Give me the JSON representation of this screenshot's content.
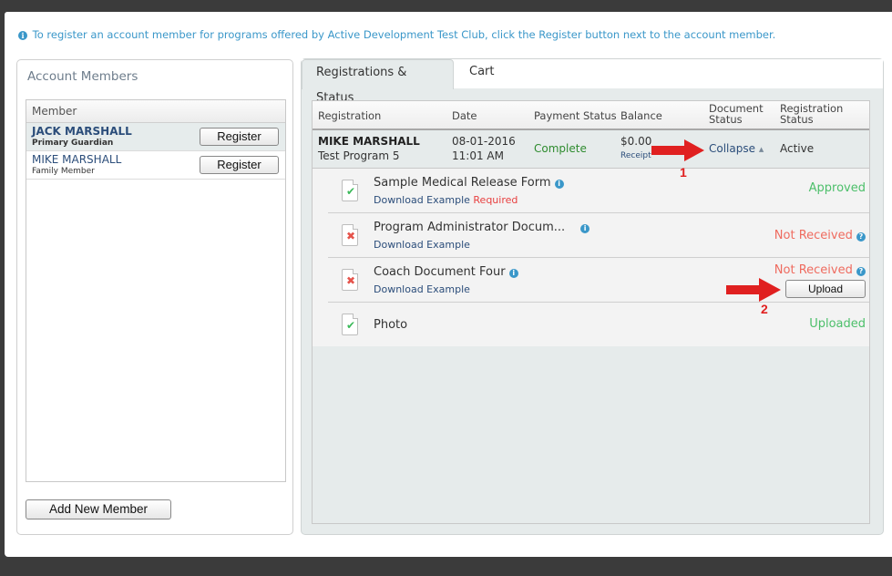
{
  "info": {
    "icon": "info-icon",
    "text": "To register an account member for programs offered by Active Development Test Club, click the Register button next to the account member."
  },
  "account_members": {
    "title": "Account Members",
    "column_header": "Member",
    "members": [
      {
        "name": "JACK MARSHALL",
        "role": "Primary Guardian",
        "selected": true,
        "button_label": "Register"
      },
      {
        "name": "MIKE MARSHALL",
        "role": "Family Member",
        "selected": false,
        "button_label": "Register"
      }
    ],
    "add_button_label": "Add New Member"
  },
  "tabs": [
    {
      "label": "Registrations & Status",
      "active": true
    },
    {
      "label": "Cart",
      "active": false
    }
  ],
  "registrations": {
    "columns": {
      "registration": "Registration",
      "date": "Date",
      "payment_status": "Payment Status",
      "balance": "Balance",
      "document_status_1": "Document",
      "document_status_2": "Status",
      "registration_status_1": "Registration",
      "registration_status_2": "Status"
    },
    "rows": [
      {
        "member": "MIKE MARSHALL",
        "program": "Test Program 5",
        "date": "08-01-2016",
        "time": "11:01 AM",
        "payment_status": "Complete",
        "balance": "$0.00",
        "receipt_label": "Receipt",
        "document_toggle": "Collapse",
        "document_toggle_icon": "caret-up-icon",
        "registration_status": "Active",
        "documents": [
          {
            "title": "Sample Medical Release Form",
            "has_info": true,
            "link": "Download Example",
            "required": "Required",
            "icon": "document-check-icon",
            "status": "Approved",
            "status_type": "ok"
          },
          {
            "title": "Program Administrator Docum...",
            "has_info": true,
            "link": "Download Example",
            "required": "",
            "icon": "document-x-icon",
            "status": "Not Received",
            "status_type": "missing",
            "has_help": true
          },
          {
            "title": "Coach Document Four",
            "has_info": true,
            "link": "Download Example",
            "required": "",
            "icon": "document-x-icon",
            "status": "Not Received",
            "status_type": "missing",
            "has_help": true,
            "upload_label": "Upload"
          },
          {
            "title": "Photo",
            "has_info": false,
            "link": "",
            "required": "",
            "icon": "document-check-icon",
            "status": "Uploaded",
            "status_type": "ok"
          }
        ]
      }
    ]
  },
  "annotations": [
    {
      "number": "1",
      "target": "collapse-link"
    },
    {
      "number": "2",
      "target": "upload-button"
    }
  ],
  "colors": {
    "accent_blue": "#3a97c9",
    "link_navy": "#2b4d7a",
    "status_green": "#4cbf6a",
    "status_red": "#ef6b5f",
    "annotation_red": "#e02020"
  }
}
